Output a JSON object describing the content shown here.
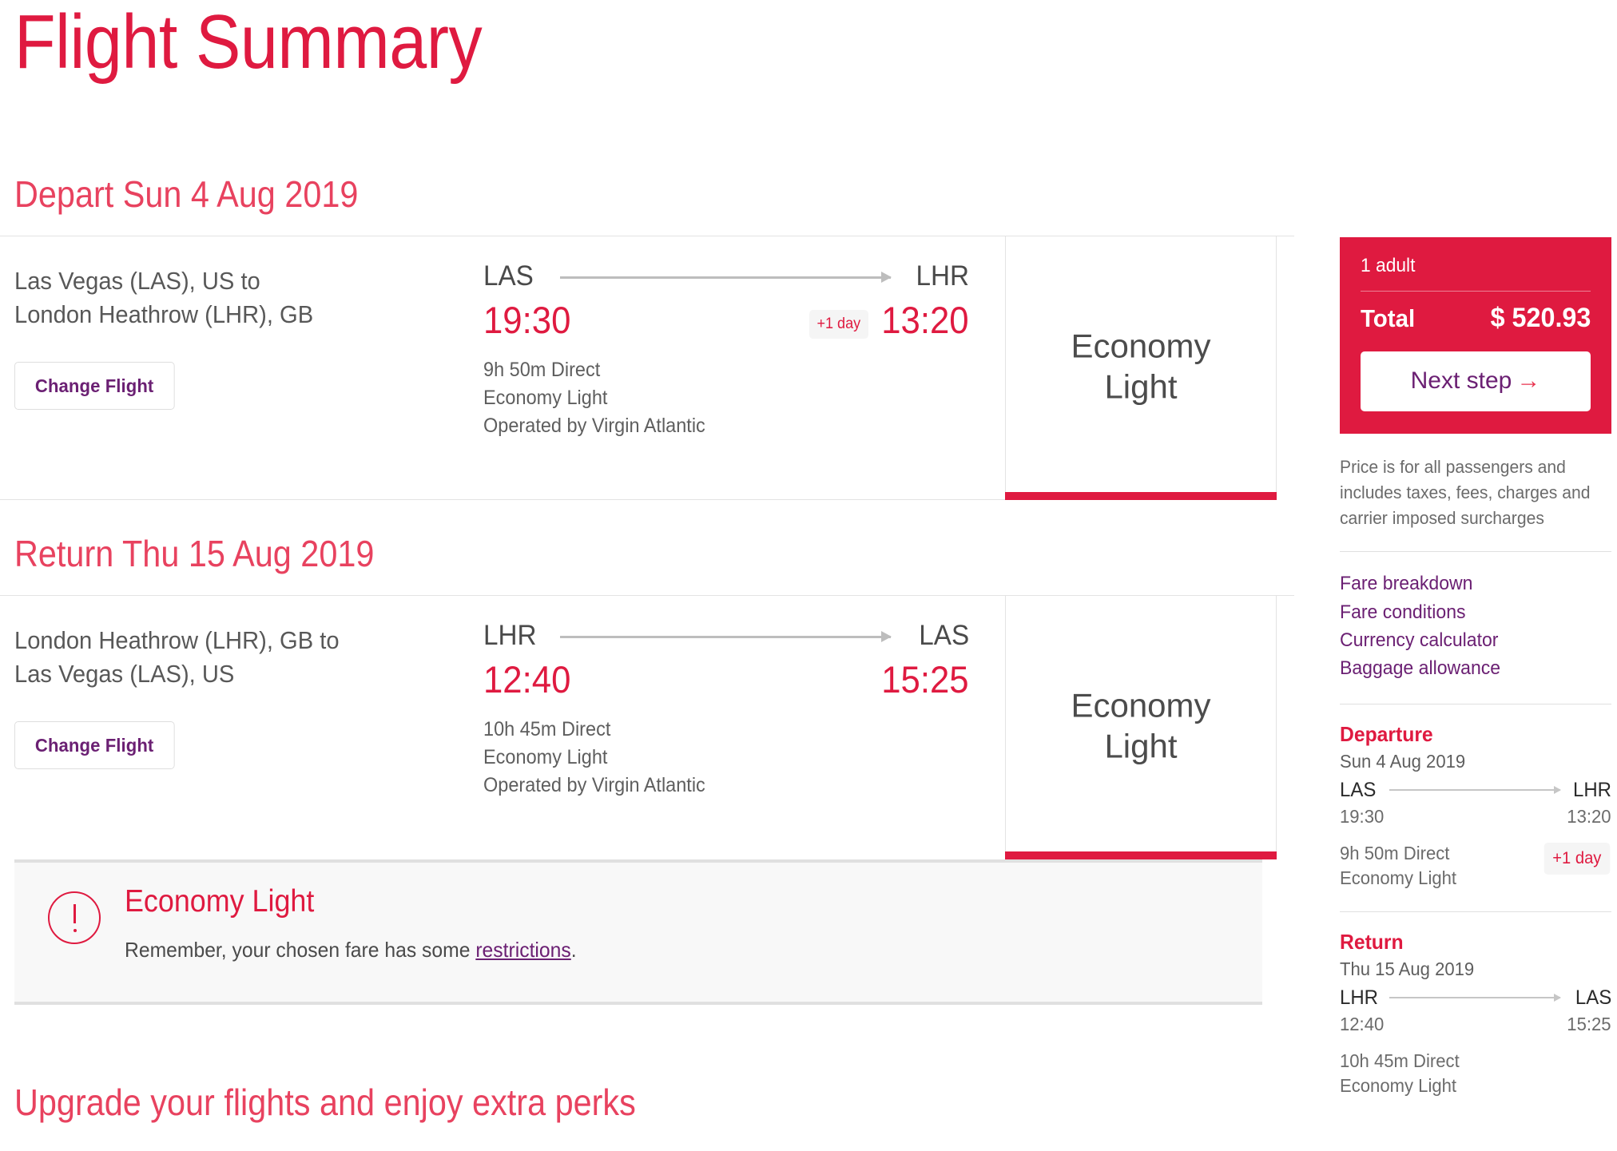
{
  "page": {
    "title": "Flight Summary",
    "upgrade_heading": "Upgrade your flights and enjoy extra perks"
  },
  "colors": {
    "brand_red": "#DF1A40",
    "heading_red": "#E8425F",
    "link_purple": "#6B2073",
    "text_gray": "#5e5e5e"
  },
  "depart": {
    "heading": "Depart Sun 4 Aug 2019",
    "route_line1": "Las Vegas (LAS), US to",
    "route_line2": "London Heathrow (LHR), GB",
    "change_flight_label": "Change Flight",
    "from_code": "LAS",
    "to_code": "LHR",
    "from_time": "19:30",
    "to_time": "13:20",
    "day_badge": "+1 day",
    "duration": "9h 50m Direct",
    "cabin": "Economy Light",
    "operator": "Operated by Virgin Atlantic",
    "cabin_panel_line1": "Economy",
    "cabin_panel_line2": "Light"
  },
  "return": {
    "heading": "Return Thu 15 Aug 2019",
    "route_line1": "London Heathrow (LHR), GB to",
    "route_line2": "Las Vegas (LAS), US",
    "change_flight_label": "Change Flight",
    "from_code": "LHR",
    "to_code": "LAS",
    "from_time": "12:40",
    "to_time": "15:25",
    "day_badge": "",
    "duration": "10h 45m Direct",
    "cabin": "Economy Light",
    "operator": "Operated by Virgin Atlantic",
    "cabin_panel_line1": "Economy",
    "cabin_panel_line2": "Light"
  },
  "alert": {
    "title": "Economy Light",
    "text_before": "Remember, your chosen fare has some ",
    "link": "restrictions",
    "text_after": "."
  },
  "sidebar": {
    "passengers": "1 adult",
    "total_label": "Total",
    "total_value": "$ 520.93",
    "next_step_label": "Next step",
    "next_step_arrow": "→",
    "price_note": "Price is for all passengers and includes taxes, fees, charges and carrier imposed surcharges",
    "links": [
      "Fare breakdown",
      "Fare conditions",
      "Currency calculator",
      "Baggage allowance"
    ],
    "departure": {
      "title": "Departure",
      "date": "Sun 4 Aug 2019",
      "from_code": "LAS",
      "to_code": "LHR",
      "from_time": "19:30",
      "to_time": "13:20",
      "duration": "9h 50m Direct",
      "cabin": "Economy Light",
      "day_badge": "+1 day"
    },
    "return": {
      "title": "Return",
      "date": "Thu 15 Aug 2019",
      "from_code": "LHR",
      "to_code": "LAS",
      "from_time": "12:40",
      "to_time": "15:25",
      "duration": "10h 45m Direct",
      "cabin": "Economy Light",
      "day_badge": ""
    }
  }
}
